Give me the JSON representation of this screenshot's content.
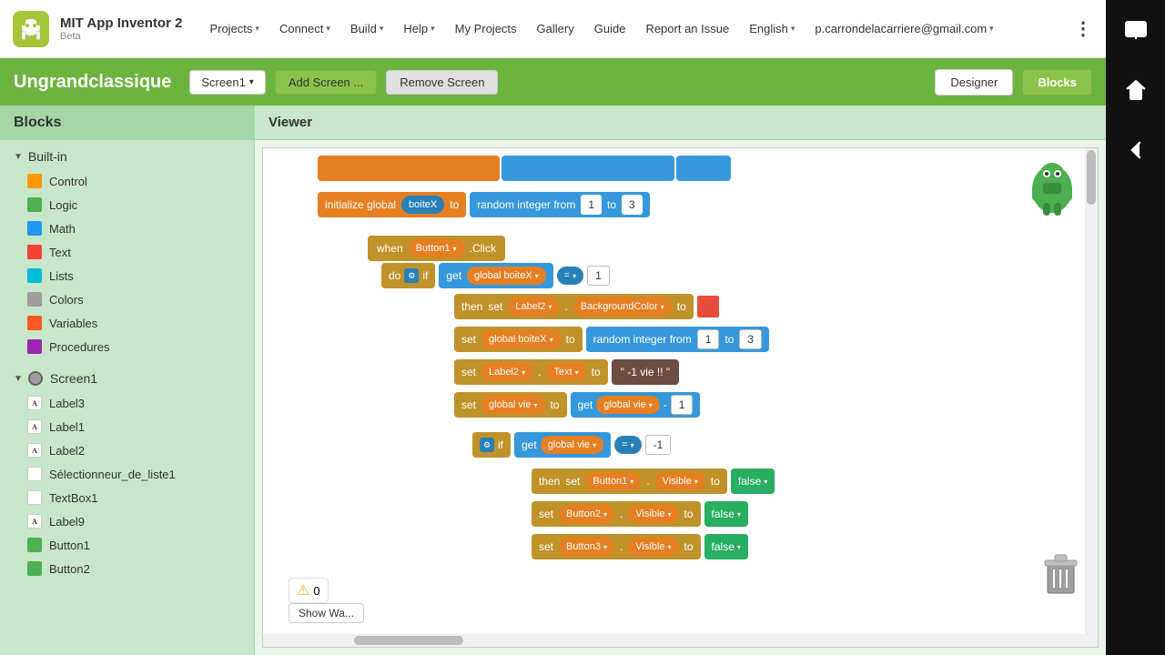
{
  "app": {
    "name": "MIT App Inventor 2",
    "subtitle": "Beta",
    "project_title": "Ungrandclassique"
  },
  "nav": {
    "items": [
      {
        "label": "Projects",
        "has_arrow": true
      },
      {
        "label": "Connect",
        "has_arrow": true
      },
      {
        "label": "Build",
        "has_arrow": true
      },
      {
        "label": "Help",
        "has_arrow": true
      },
      {
        "label": "My Projects",
        "has_arrow": false
      },
      {
        "label": "Gallery",
        "has_arrow": false
      },
      {
        "label": "Guide",
        "has_arrow": false
      },
      {
        "label": "Report an Issue",
        "has_arrow": false
      },
      {
        "label": "English",
        "has_arrow": true
      },
      {
        "label": "p.carrondelacarriere@gmail.com",
        "has_arrow": false
      }
    ]
  },
  "toolbar": {
    "screen_label": "Screen1",
    "add_screen_label": "Add Screen ...",
    "remove_screen_label": "Remove Screen",
    "designer_label": "Designer",
    "blocks_label": "Blocks"
  },
  "sidebar": {
    "header": "Blocks",
    "builtin_label": "Built-in",
    "items": [
      {
        "label": "Control",
        "icon": "control"
      },
      {
        "label": "Logic",
        "icon": "logic"
      },
      {
        "label": "Math",
        "icon": "math"
      },
      {
        "label": "Text",
        "icon": "text"
      },
      {
        "label": "Lists",
        "icon": "lists"
      },
      {
        "label": "Colors",
        "icon": "colors"
      },
      {
        "label": "Variables",
        "icon": "variables"
      },
      {
        "label": "Procedures",
        "icon": "procedures"
      }
    ],
    "screen_label": "Screen1",
    "screen_items": [
      {
        "label": "Label3",
        "icon": "label"
      },
      {
        "label": "Label1",
        "icon": "label"
      },
      {
        "label": "Label2",
        "icon": "label"
      },
      {
        "label": "Sélectionneur_de_liste1",
        "icon": "selector"
      },
      {
        "label": "TextBox1",
        "icon": "textbox"
      },
      {
        "label": "Label9",
        "icon": "label"
      },
      {
        "label": "Button1",
        "icon": "button"
      },
      {
        "label": "Button2",
        "icon": "button"
      }
    ]
  },
  "viewer": {
    "header": "Viewer"
  },
  "warning": {
    "count": "0",
    "show_label": "Show Wa..."
  },
  "blocks_data": {
    "init_global": "initialize global",
    "boiteX": "boiteX",
    "to_label": "to",
    "random_integer_from": "random integer from",
    "val_1": "1",
    "val_3": "3",
    "when_label": "when",
    "button1_label": "Button1",
    "click_label": ".Click",
    "do_label": "do",
    "if_label": "if",
    "get_label": "get",
    "global_boiteX": "global boiteX",
    "equals": "=",
    "then_label": "then",
    "set_label": "set",
    "label2": "Label2",
    "backgroundcolor": "BackgroundColor",
    "set_global_boiteX": "global boiteX",
    "random_int_1": "1",
    "random_int_3": "3",
    "text_label": "Text",
    "minus1_vie": "\" -1 vie !! \"",
    "global_vie": "global vie",
    "get_global_vie": "global vie",
    "minus": "-",
    "val_minus1": "-1",
    "if2_label": "if",
    "get_global_vie2": "global vie",
    "eq_minus1": "-1",
    "then2_label": "then",
    "button1_visible": "Button1",
    "visible_label": "Visible",
    "false_label": "false",
    "button2_visible": "Button2",
    "button3_visible": "Button3",
    "false2_label": "false",
    "false3_label": "false"
  }
}
